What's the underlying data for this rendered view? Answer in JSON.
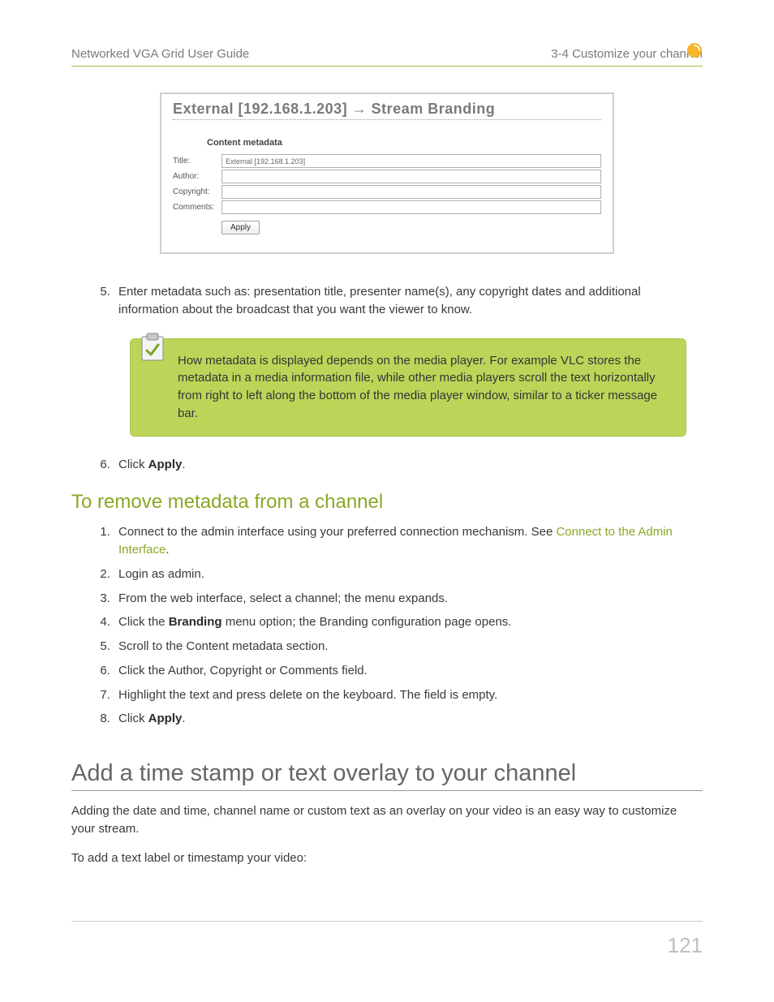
{
  "header": {
    "left": "Networked VGA Grid User Guide",
    "right": "3-4 Customize your channel"
  },
  "screenshot": {
    "title_pre": "External [192.168.1.203]",
    "title_post": "Stream Branding",
    "section": "Content metadata",
    "labels": {
      "title": "Title:",
      "author": "Author:",
      "copyright": "Copyright:",
      "comments": "Comments:"
    },
    "title_value": "External [192.168.1.203]",
    "apply": "Apply"
  },
  "list1": {
    "n5": "5.",
    "t5": "Enter metadata such as: presentation title, presenter name(s), any copyright dates and additional information about the broadcast that you want the viewer to know.",
    "callout": "How metadata is displayed depends on the media player. For example VLC stores the metadata in a media information file, while other media players scroll the text horizontally from right to left along the bottom of the media player window, similar to a ticker message bar.",
    "n6": "6.",
    "t6a": "Click ",
    "t6b": "Apply",
    "t6c": "."
  },
  "h3": "To remove metadata from a channel",
  "list2": {
    "i1a": "Connect to the admin interface using your preferred connection mechanism. See ",
    "i1link": "Connect to the Admin Interface",
    "i1b": ".",
    "i2": "Login as admin.",
    "i3": "From the web interface, select a channel; the menu expands.",
    "i4a": "Click the ",
    "i4b": "Branding",
    "i4c": " menu option; the Branding configuration page opens.",
    "i5": "Scroll to the Content metadata section.",
    "i6": "Click the Author, Copyright or Comments field.",
    "i7": "Highlight the text and press delete on the keyboard. The field is empty.",
    "i8a": "Click ",
    "i8b": "Apply",
    "i8c": "."
  },
  "h2": "Add a time stamp or text overlay to your channel",
  "p1": "Adding the date and time, channel name or custom text as an overlay on your video is an easy way to customize your stream.",
  "p2": "To add a text label or timestamp your video:",
  "page": "121"
}
